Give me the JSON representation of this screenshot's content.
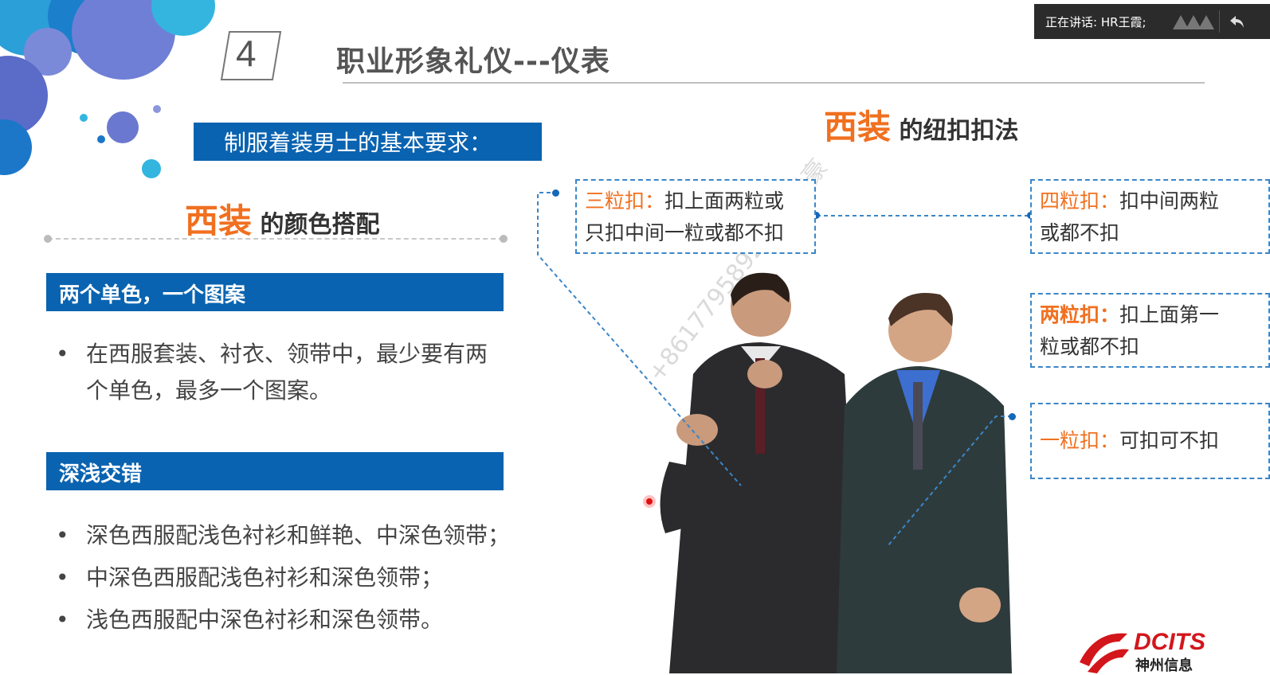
{
  "header": {
    "section_number": "4",
    "title": "职业形象礼仪---仪表"
  },
  "left": {
    "requirement_label": "制服着装男士的基本要求：",
    "color_heading": {
      "accent": "西装",
      "rest": " 的颜色搭配"
    },
    "bar1_label": "两个单色，一个图案",
    "bar1_items": [
      "在西服套装、衬衣、领带中，最少要有两",
      "个单色，最多一个图案。"
    ],
    "bar2_label": "深浅交错",
    "bar2_items": [
      "深色西服配浅色衬衫和鲜艳、中深色领带；",
      "中深色西服配浅色衬衫和深色领带；",
      "浅色西服配中深色衬衫和深色领带。"
    ]
  },
  "right": {
    "button_heading": {
      "accent": "西装",
      "rest": " 的纽扣扣法"
    },
    "three": {
      "key": "三粒扣：",
      "line1": "扣上面两粒或",
      "line2": "只扣中间一粒或都不扣"
    },
    "four": {
      "key": "四粒扣：",
      "line1": "扣中间两粒",
      "line2": "或都不扣"
    },
    "two": {
      "key": "两粒扣：",
      "line1": "扣上面第一",
      "line2": "粒或都不扣"
    },
    "one": {
      "key": "一粒扣：",
      "line1": "可扣可不扣"
    }
  },
  "overlay": {
    "speaking": "正在讲话: HR王霞;",
    "watermark": "+8617795892 2 刘君豪",
    "logo_text": "DCITS",
    "logo_sub": "神州信息"
  },
  "colors": {
    "accent_orange": "#f07020",
    "bar_blue": "#0a63b0",
    "dash_blue": "#3a86c8"
  }
}
